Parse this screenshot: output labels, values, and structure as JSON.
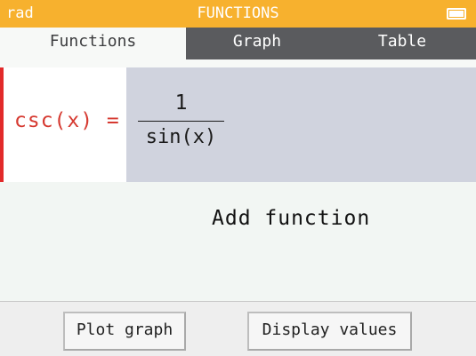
{
  "status_bar": {
    "angle_mode": "rad",
    "title": "FUNCTIONS",
    "battery_icon": "battery-full-icon"
  },
  "tabs": [
    {
      "label": "Functions",
      "active": true
    },
    {
      "label": "Graph",
      "active": false
    },
    {
      "label": "Table",
      "active": false
    }
  ],
  "functions": [
    {
      "name": "csc(x) =",
      "numerator": "1",
      "denominator": "sin(x)",
      "color": "#e22a2a"
    }
  ],
  "add_function_label": "Add function",
  "buttons": {
    "plot_label": "Plot graph",
    "values_label": "Display values"
  },
  "colors": {
    "status_bar": "#f7b12e",
    "tab_bar": "#5a5b5e",
    "expression_bg": "#d0d3de",
    "function_name": "#d63a31"
  }
}
